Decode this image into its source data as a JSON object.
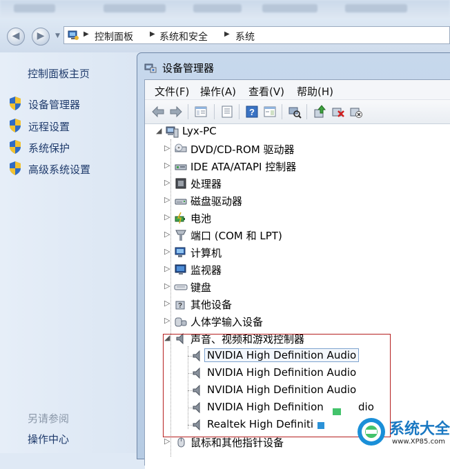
{
  "explorer": {
    "breadcrumb": [
      "控制面板",
      "系统和安全",
      "系统"
    ]
  },
  "left_panel": {
    "home_link": "控制面板主页",
    "links": [
      "设备管理器",
      "远程设置",
      "系统保护",
      "高级系统设置"
    ],
    "see_also_label": "另请参阅",
    "see_also_link": "操作中心"
  },
  "device_manager": {
    "title": "设备管理器",
    "menu": [
      "文件(F)",
      "操作(A)",
      "查看(V)",
      "帮助(H)"
    ],
    "toolbar_icons": [
      "back-icon",
      "forward-icon",
      "show-hide-tree-icon",
      "properties-icon",
      "help-icon",
      "action-pane-icon",
      "scan-hardware-icon",
      "update-driver-icon",
      "uninstall-icon",
      "disable-icon"
    ],
    "root": "Lyx-PC",
    "categories": [
      {
        "label": "DVD/CD-ROM 驱动器",
        "icon": "dvd-drive-icon"
      },
      {
        "label": "IDE ATA/ATAPI 控制器",
        "icon": "ide-controller-icon"
      },
      {
        "label": "处理器",
        "icon": "processor-icon"
      },
      {
        "label": "磁盘驱动器",
        "icon": "disk-drive-icon"
      },
      {
        "label": "电池",
        "icon": "battery-icon"
      },
      {
        "label": "端口 (COM 和 LPT)",
        "icon": "port-icon"
      },
      {
        "label": "计算机",
        "icon": "computer-icon"
      },
      {
        "label": "监视器",
        "icon": "monitor-icon"
      },
      {
        "label": "键盘",
        "icon": "keyboard-icon"
      },
      {
        "label": "其他设备",
        "icon": "other-devices-icon"
      },
      {
        "label": "人体学输入设备",
        "icon": "hid-icon"
      },
      {
        "label": "声音、视频和游戏控制器",
        "icon": "speaker-icon",
        "expanded": true
      },
      {
        "label": "鼠标和其他指针设备",
        "icon": "mouse-icon"
      }
    ],
    "sound_devices": [
      "NVIDIA High Definition Audio",
      "NVIDIA High Definition Audio",
      "NVIDIA High Definition Audio",
      "NVIDIA High Definition Audio",
      "Realtek High Definition Audio"
    ],
    "sound_devices_visible": [
      "NVIDIA High Definition Audio",
      "NVIDIA High Definition Audio",
      "NVIDIA High Definition Audio",
      "NVIDIA High Definition",
      "dio",
      "Realtek High Definiti"
    ]
  },
  "watermark": {
    "text": "系统大全",
    "url": "www.XP85.com"
  },
  "colors": {
    "highlight_border": "#b51e1e",
    "link": "#1e3a6b",
    "watermark_blue": "#1a78c2"
  }
}
